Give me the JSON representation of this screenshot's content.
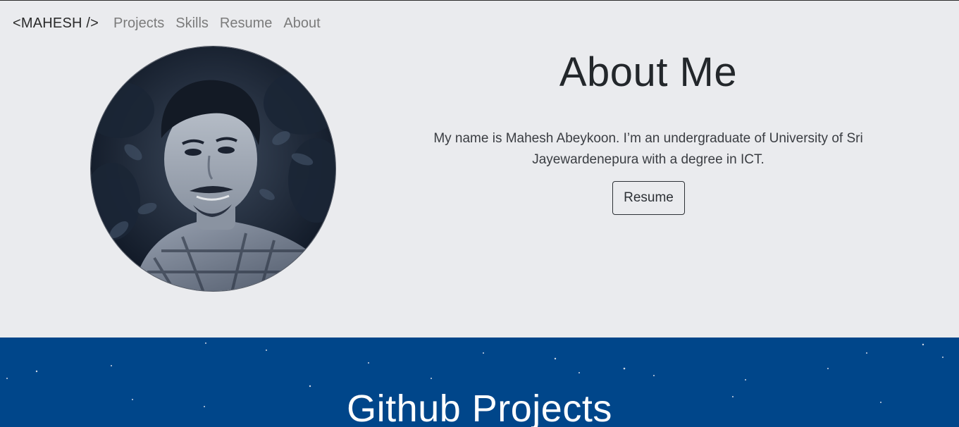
{
  "nav": {
    "brand": "<MAHESH />",
    "links": [
      "Projects",
      "Skills",
      "Resume",
      "About"
    ]
  },
  "about": {
    "title": "About Me",
    "text": "My name is Mahesh Abeykoon. I’m an undergraduate of University of Sri Jayewardenepura with a degree in ICT.",
    "resume_button": "Resume"
  },
  "projects": {
    "title": "Github Projects"
  },
  "colors": {
    "page_background": "#eaebee",
    "projects_background": "#00468a",
    "heading_text": "#23272b",
    "nav_link": "#7b7b7b"
  },
  "icons": {
    "avatar": "profile-photo"
  }
}
